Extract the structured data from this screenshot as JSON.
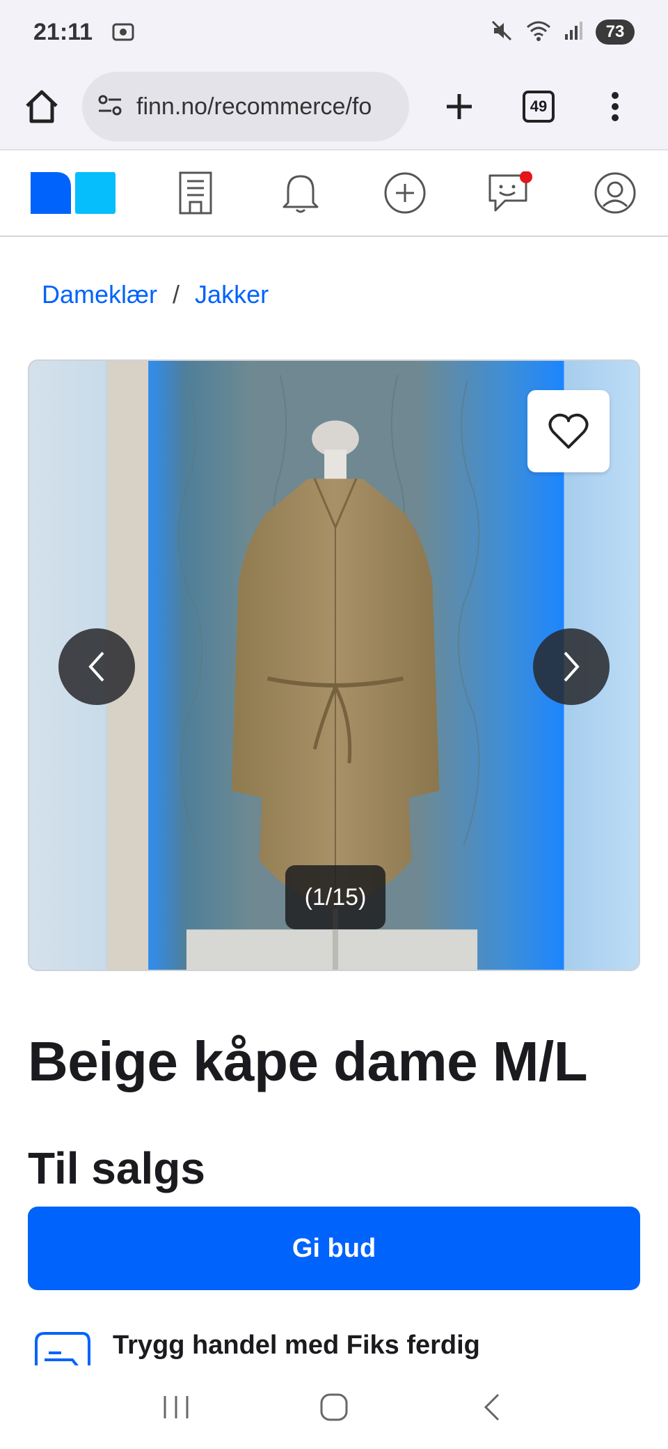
{
  "status_bar": {
    "time": "21:11",
    "battery": "73"
  },
  "browser": {
    "url": "finn.no/recommerce/fo",
    "tab_count": "49"
  },
  "breadcrumb": {
    "items": [
      "Dameklær",
      "Jakker"
    ],
    "separator": "/"
  },
  "gallery": {
    "counter": "(1/15)"
  },
  "listing": {
    "title": "Beige kåpe dame M/L",
    "sale_type": "Til salgs",
    "bid_button": "Gi bud",
    "fiks_ferdig": "Trygg handel med Fiks ferdig"
  },
  "colors": {
    "brand_blue": "#0063fb",
    "logo_light_blue": "#06befb",
    "notification_red": "#e4161b"
  }
}
